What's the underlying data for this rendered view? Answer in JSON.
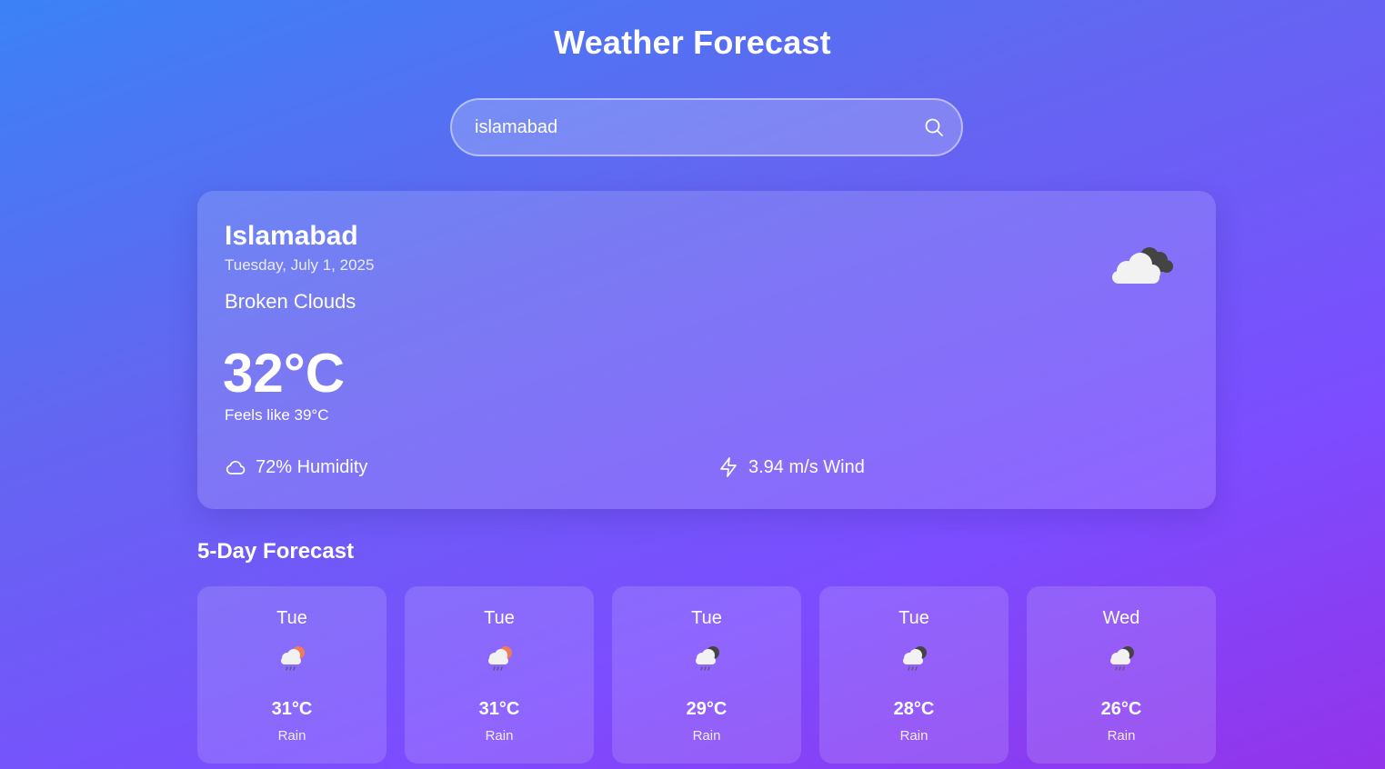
{
  "header": {
    "title": "Weather Forecast"
  },
  "search": {
    "value": "islamabad",
    "placeholder": "",
    "button_icon": "search-icon"
  },
  "current": {
    "city": "Islamabad",
    "date": "Tuesday, July 1, 2025",
    "condition": "Broken Clouds",
    "temperature": "32°C",
    "feels_like": "Feels like 39°C",
    "icon": "broken-clouds-icon",
    "humidity": {
      "icon": "cloud-icon",
      "text": "72% Humidity"
    },
    "wind": {
      "icon": "lightning-icon",
      "text": "3.94 m/s Wind"
    }
  },
  "forecast": {
    "heading": "5-Day Forecast",
    "days": [
      {
        "day": "Tue",
        "temp": "31°C",
        "desc": "Rain",
        "icon": "rain-sun-icon"
      },
      {
        "day": "Tue",
        "temp": "31°C",
        "desc": "Rain",
        "icon": "rain-sun-icon"
      },
      {
        "day": "Tue",
        "temp": "29°C",
        "desc": "Rain",
        "icon": "rain-night-icon"
      },
      {
        "day": "Tue",
        "temp": "28°C",
        "desc": "Rain",
        "icon": "rain-night-icon"
      },
      {
        "day": "Wed",
        "temp": "26°C",
        "desc": "Rain",
        "icon": "rain-night-icon"
      }
    ]
  },
  "colors": {
    "sun": "#f07a5a",
    "dark_cloud": "#444444",
    "light_cloud": "#f2f2f2"
  }
}
